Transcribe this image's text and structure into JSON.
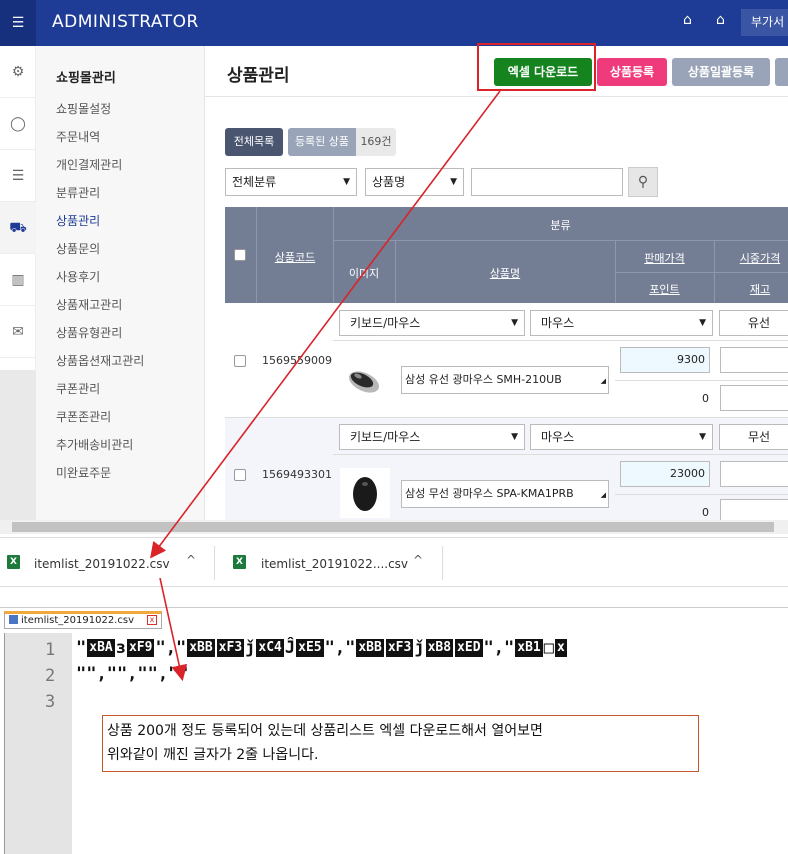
{
  "header": {
    "title": "ADMINISTRATOR",
    "addon_label": "부가서",
    "hamburger_icon": "collapse-menu-icon",
    "store_icon": "store-icon",
    "home_icon": "home-icon"
  },
  "rail": {
    "icons": [
      "gear-icon",
      "user-icon",
      "list-icon",
      "cart-icon",
      "bar-chart-icon",
      "mail-icon"
    ]
  },
  "menu": {
    "title": "쇼핑몰관리",
    "items": [
      {
        "label": "쇼핑몰설정"
      },
      {
        "label": "주문내역"
      },
      {
        "label": "개인결제관리"
      },
      {
        "label": "분류관리"
      },
      {
        "label": "상품관리"
      },
      {
        "label": "상품문의"
      },
      {
        "label": "사용후기"
      },
      {
        "label": "상품재고관리"
      },
      {
        "label": "상품유형관리"
      },
      {
        "label": "상품옵션재고관리"
      },
      {
        "label": "쿠폰관리"
      },
      {
        "label": "쿠폰존관리"
      },
      {
        "label": "추가배송비관리"
      },
      {
        "label": "미완료주문"
      }
    ],
    "active_index": 4
  },
  "main": {
    "title": "상품관리",
    "buttons": {
      "excel": "엑셀 다운로드",
      "register": "상품등록",
      "bulk": "상품일괄등록"
    },
    "tabs": {
      "all": "전체목록",
      "registered": "등록된 상품",
      "count": "169건"
    },
    "filter": {
      "category": "전체분류",
      "field": "상품명",
      "query": ""
    }
  },
  "table": {
    "headers": {
      "code": "상품코드",
      "category": "분류",
      "image": "이미지",
      "name": "상품명",
      "sale_price": "판매가격",
      "market_price": "시중가격",
      "point": "포인트",
      "stock": "재고"
    },
    "rows": [
      {
        "code": "1569559009",
        "cat1": "키보드/마우스",
        "cat2": "마우스",
        "cat3": "유선",
        "name": "삼성 유선 광마우스 SMH-210UB",
        "price": "9300",
        "point": "0"
      },
      {
        "code": "1569493301",
        "cat1": "키보드/마우스",
        "cat2": "마우스",
        "cat3": "무선",
        "name": "삼성 무선 광마우스 SPA-KMA1PRB",
        "price": "23000",
        "point": "0"
      }
    ]
  },
  "downloads": [
    {
      "name": "itemlist_20191022.csv"
    },
    {
      "name": "itemlist_20191022....csv"
    }
  ],
  "editor": {
    "tab_name": "itemlist_20191022.csv",
    "line_numbers": [
      "1",
      "2",
      "3"
    ],
    "line1": [
      {
        "t": "\""
      },
      {
        "b": "xBA"
      },
      {
        "t": "з"
      },
      {
        "b": "xF9"
      },
      {
        "t": "\",\""
      },
      {
        "b": "xBB"
      },
      {
        "b": "xF3"
      },
      {
        "t": "ǰ"
      },
      {
        "b": "xC4"
      },
      {
        "t": "Ĵ"
      },
      {
        "b": "xE5"
      },
      {
        "t": "\",\""
      },
      {
        "b": "xBB"
      },
      {
        "b": "xF3"
      },
      {
        "t": "ǰ"
      },
      {
        "b": "xB8"
      },
      {
        "b": "xED"
      },
      {
        "t": "\",\""
      },
      {
        "b": "xB1"
      },
      {
        "t": "□"
      },
      {
        "b": "x"
      }
    ],
    "line2": "\"\",\"\",\"\",\"\""
  },
  "note": {
    "line1": "상품 200개 정도 등록되어 있는데 상품리스트 엑셀 다운로드해서 열어보면",
    "line2": "위와같이 깨진 글자가 2줄 나옵니다."
  },
  "colors": {
    "header_bg": "#1e3c96",
    "excel_button": "#16841e",
    "register_button": "#ef3b7c",
    "annotation": "#d9242a"
  }
}
